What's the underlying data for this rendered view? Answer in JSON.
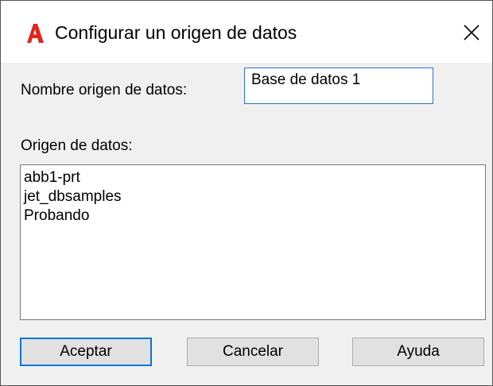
{
  "window": {
    "title": "Configurar un origen de datos",
    "app_icon": "autocad-a-logo-icon",
    "close_icon": "close-icon"
  },
  "form": {
    "name_label": "Nombre origen de datos:",
    "name_value": "Base de datos 1",
    "source_label": "Origen de datos:",
    "sources": [
      "abb1-prt",
      "jet_dbsamples",
      "Probando"
    ]
  },
  "buttons": {
    "accept": "Aceptar",
    "cancel": "Cancelar",
    "help": "Ayuda"
  },
  "colors": {
    "logo_red": "#e1261c",
    "focus_blue": "#0078d7"
  }
}
